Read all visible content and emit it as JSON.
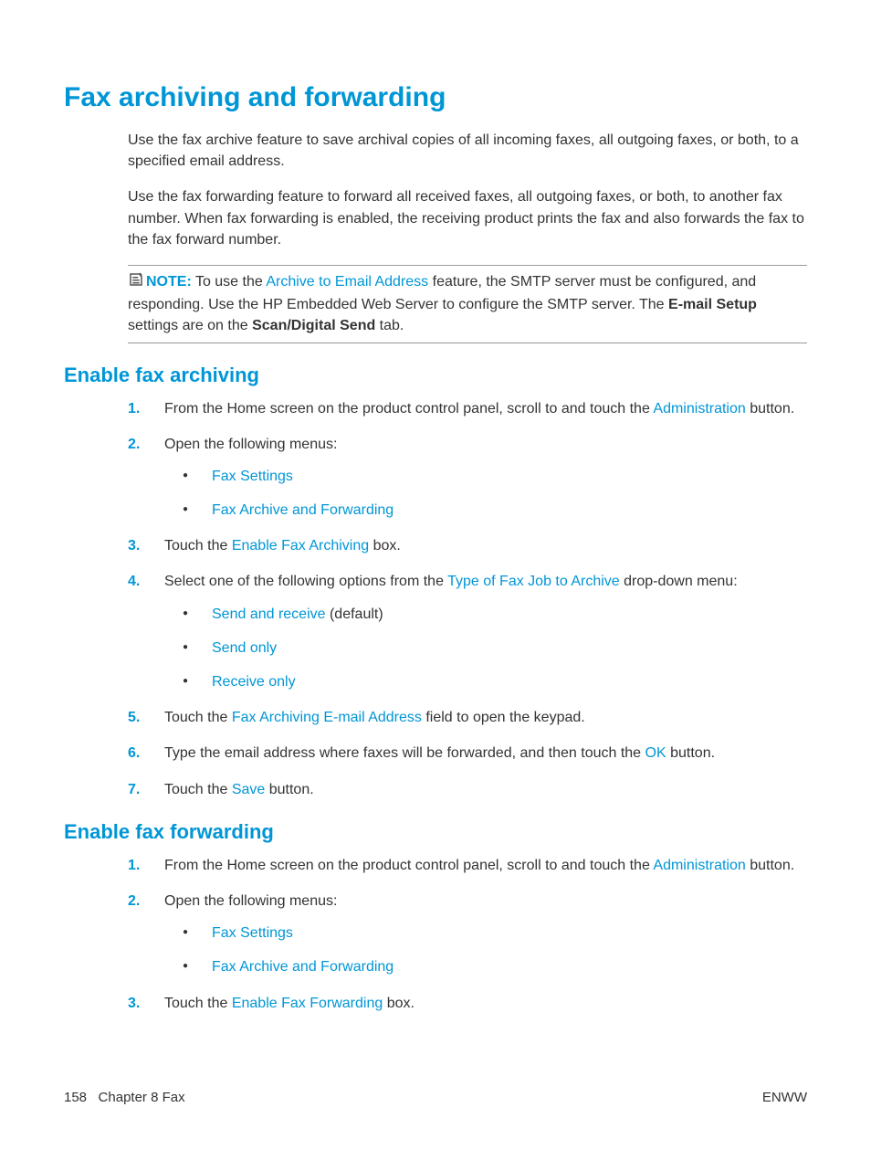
{
  "h1": "Fax archiving and forwarding",
  "intro1": "Use the fax archive feature to save archival copies of all incoming faxes, all outgoing faxes, or both, to a specified email address.",
  "intro2": "Use the fax forwarding feature to forward all received faxes, all outgoing faxes, or both, to another fax number. When fax forwarding is enabled, the receiving product prints the fax and also forwards the fax to the fax forward number.",
  "note": {
    "label": "NOTE:",
    "pre": "To use the ",
    "link": "Archive to Email Address",
    "mid": " feature, the SMTP server must be configured, and responding. Use the HP Embedded Web Server to configure the SMTP server. The ",
    "bold1": "E-mail Setup",
    "mid2": " settings are on the ",
    "bold2": "Scan/Digital Send",
    "post": " tab."
  },
  "h2a": "Enable fax archiving",
  "a1": {
    "pre": "From the Home screen on the product control panel, scroll to and touch the ",
    "link": "Administration",
    "post": " button."
  },
  "a2": "Open the following menus:",
  "a2b": [
    "Fax Settings",
    "Fax Archive and Forwarding"
  ],
  "a3": {
    "pre": "Touch the ",
    "link": "Enable Fax Archiving",
    "post": " box."
  },
  "a4": {
    "pre": "Select one of the following options from the ",
    "link": "Type of Fax Job to Archive",
    "post": " drop-down menu:"
  },
  "a4b": [
    {
      "link": "Send and receive",
      "post": " (default)"
    },
    {
      "link": "Send only",
      "post": ""
    },
    {
      "link": "Receive only",
      "post": ""
    }
  ],
  "a5": {
    "pre": "Touch the ",
    "link": "Fax Archiving E-mail Address",
    "post": " field to open the keypad."
  },
  "a6": {
    "pre": "Type the email address where faxes will be forwarded, and then touch the ",
    "link": "OK",
    "post": " button."
  },
  "a7": {
    "pre": "Touch the ",
    "link": "Save",
    "post": " button."
  },
  "h2b": "Enable fax forwarding",
  "b1": {
    "pre": "From the Home screen on the product control panel, scroll to and touch the ",
    "link": "Administration",
    "post": " button."
  },
  "b2": "Open the following menus:",
  "b2b": [
    "Fax Settings",
    "Fax Archive and Forwarding"
  ],
  "b3": {
    "pre": "Touch the ",
    "link": "Enable Fax Forwarding",
    "post": " box."
  },
  "footer": {
    "page": "158",
    "chapter": "Chapter 8   Fax",
    "right": "ENWW"
  }
}
